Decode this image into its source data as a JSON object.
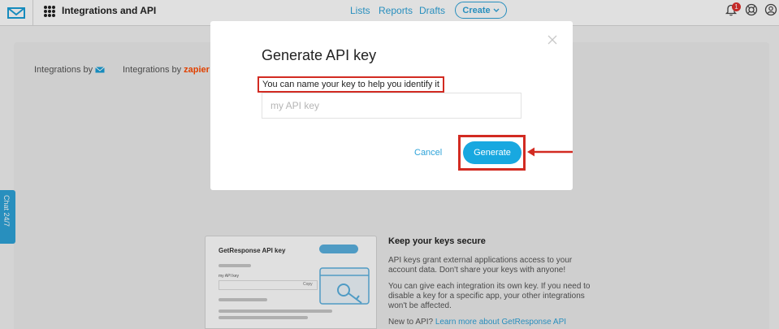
{
  "topbar": {
    "app_name": "Integrations and API",
    "nav": [
      "Lists",
      "Reports",
      "Drafts"
    ],
    "create_label": "Create",
    "notification_count": "1"
  },
  "page": {
    "integrations_by": "Integrations by",
    "integrations_by_zapier": "Integrations by",
    "zapier_brand": "zapier",
    "chat_label": "Chat 24/7"
  },
  "illustration": {
    "title": "GetResponse API key",
    "field_label": "my API key",
    "copy_label": "Copy"
  },
  "secure": {
    "title": "Keep your keys secure",
    "p1": "API keys grant external applications access to your account data. Don't share your keys with anyone!",
    "p2": "You can give each integration its own key. If you need to disable a key for a specific app, your other integrations won't be affected.",
    "new_prefix": "New to API?",
    "new_link": "Learn more about GetResponse API"
  },
  "modal": {
    "title": "Generate API key",
    "hint": "You can name your key to help you identify it",
    "input_placeholder": "my API key",
    "input_value": "",
    "cancel_label": "Cancel",
    "generate_label": "Generate"
  },
  "colors": {
    "accent": "#2ea3d9",
    "highlight": "#d22b22",
    "zapier": "#ff4a00"
  }
}
